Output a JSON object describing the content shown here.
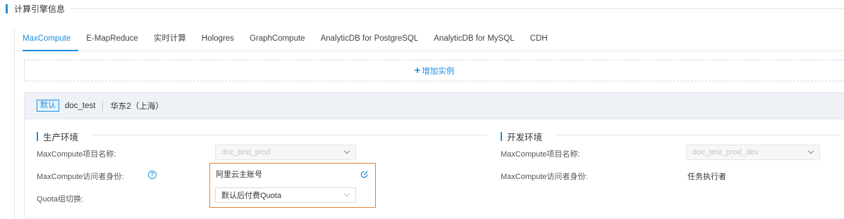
{
  "section": {
    "title": "计算引擎信息"
  },
  "tabs": [
    {
      "label": "MaxCompute",
      "active": true
    },
    {
      "label": "E-MapReduce"
    },
    {
      "label": "实时计算"
    },
    {
      "label": "Hologres"
    },
    {
      "label": "GraphCompute"
    },
    {
      "label": "AnalyticDB for PostgreSQL"
    },
    {
      "label": "AnalyticDB for MySQL"
    },
    {
      "label": "CDH"
    }
  ],
  "add_instance": {
    "icon": "plus-icon",
    "label": "增加实例"
  },
  "instance": {
    "badge": "默认",
    "name": "doc_test",
    "region": "华东2（上海）"
  },
  "production": {
    "title": "生产环境",
    "project_label": "MaxCompute项目名称:",
    "project_value": "doc_test_prod",
    "identity_label": "MaxCompute访问者身份:",
    "identity_value": "阿里云主账号",
    "quota_label": "Quota组切换:",
    "quota_value": "默认后付费Quota"
  },
  "development": {
    "title": "开发环境",
    "project_label": "MaxCompute项目名称:",
    "project_value": "doc_test_prod_dev",
    "identity_label": "MaxCompute访问者身份:",
    "identity_value": "任务执行者"
  },
  "colors": {
    "accent": "#1e8fe1",
    "highlight": "#e5822e"
  }
}
